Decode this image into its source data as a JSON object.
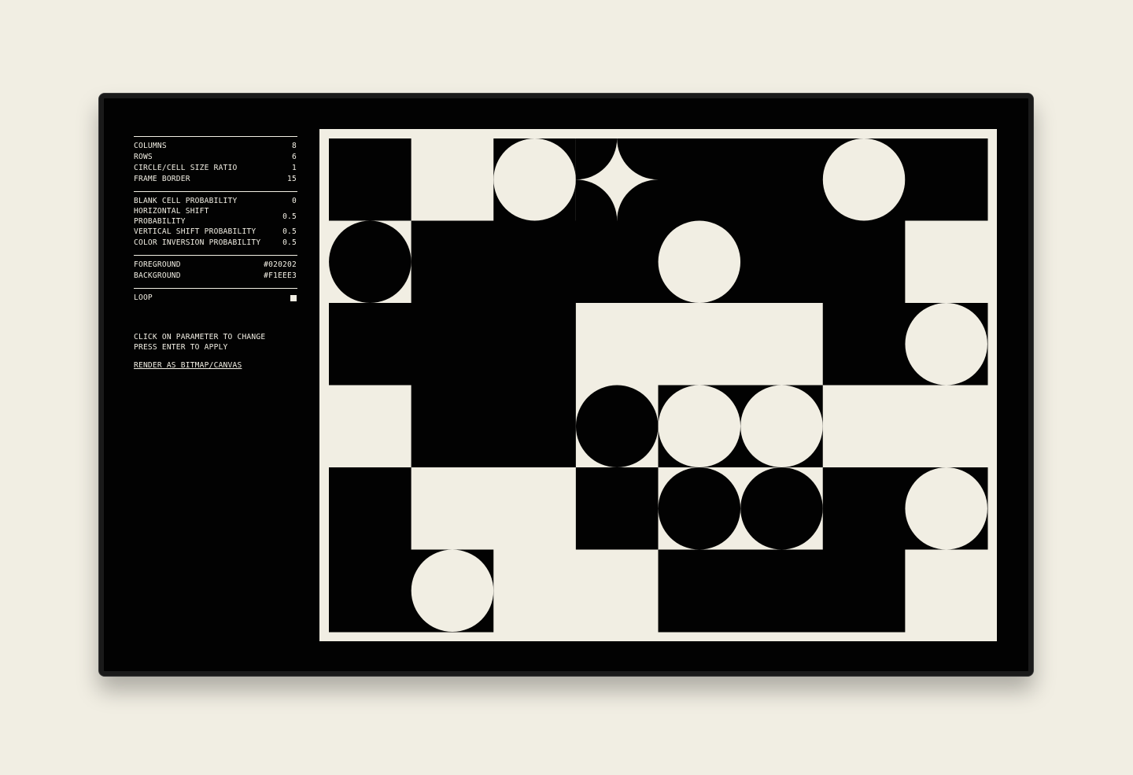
{
  "params": {
    "grid": [
      {
        "label": "COLUMNS",
        "value": "8"
      },
      {
        "label": "ROWS",
        "value": "6"
      },
      {
        "label": "CIRCLE/CELL SIZE RATIO",
        "value": "1"
      },
      {
        "label": "FRAME BORDER",
        "value": "15"
      }
    ],
    "probabilities": [
      {
        "label": "BLANK CELL PROBABILITY",
        "value": "0"
      },
      {
        "label": "HORIZONTAL SHIFT PROBABILITY",
        "value": "0.5"
      },
      {
        "label": "VERTICAL SHIFT PROBABILITY",
        "value": "0.5"
      },
      {
        "label": "COLOR INVERSION PROBABILITY",
        "value": "0.5"
      }
    ],
    "colors": [
      {
        "label": "FOREGROUND",
        "value": "#020202"
      },
      {
        "label": "BACKGROUND",
        "value": "#F1EEE3"
      }
    ],
    "loop": {
      "label": "LOOP",
      "checked": true
    }
  },
  "help": {
    "line1": "CLICK ON PARAMETER TO CHANGE",
    "line2": "PRESS ENTER TO APPLY",
    "render_link": "RENDER AS BITMAP/CANVAS"
  },
  "pattern": {
    "columns": 8,
    "rows": 6,
    "frame_border": 15,
    "foreground": "#020202",
    "background": "#F1EEE3",
    "cells": [
      [
        "dark",
        "cream",
        "circle-lightbg",
        "star",
        "dark",
        "dark",
        "circle-lightbg",
        "dark"
      ],
      [
        "circle-darkbg",
        "dark",
        "dark",
        "dark",
        "circle-lightbg",
        "dark",
        "dark",
        "cream"
      ],
      [
        "dark",
        "dark",
        "dark",
        "cream",
        "cream",
        "cream",
        "dark",
        "circle-lightbg"
      ],
      [
        "cream",
        "dark",
        "dark",
        "circle-darkbg",
        "circle-lightbg",
        "circle-lightbg",
        "cream",
        "cream"
      ],
      [
        "dark",
        "cream",
        "cream",
        "dark",
        "circle-darkbg",
        "circle-darkbg",
        "dark",
        "circle-lightbg"
      ],
      [
        "dark",
        "circle-lightbg",
        "cream",
        "cream",
        "dark",
        "dark",
        "dark",
        "cream"
      ]
    ]
  }
}
